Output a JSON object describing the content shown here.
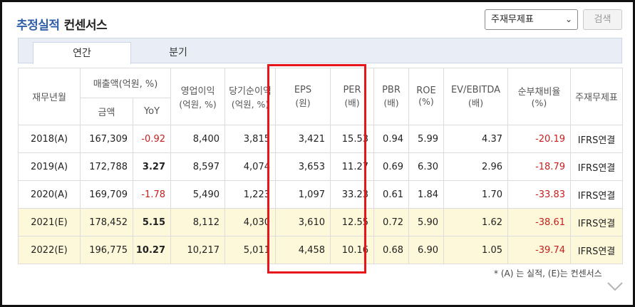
{
  "title": {
    "main": "추정실적",
    "sub": "컨센서스"
  },
  "select": {
    "value": "주재무제표"
  },
  "search_label": "검색",
  "tabs": [
    {
      "label": "연간"
    },
    {
      "label": "분기"
    }
  ],
  "columns": {
    "period": "재무년월",
    "sales": "매출액(억원, %)",
    "sales_amount": "금액",
    "sales_yoy": "YoY",
    "op_line1": "영업이익",
    "op_line2": "(억원, %)",
    "ni_line1": "당기순이익",
    "ni_line2": "(억원, %)",
    "eps_line1": "EPS",
    "eps_line2": "(원)",
    "per_line1": "PER",
    "per_line2": "(배)",
    "pbr_line1": "PBR",
    "pbr_line2": "(배)",
    "roe_line1": "ROE",
    "roe_line2": "(%)",
    "ev_line1": "EV/EBITDA",
    "ev_line2": "(배)",
    "debt_line1": "순부채비율",
    "debt_line2": "(%)",
    "basis": "주재무제표"
  },
  "rows": [
    {
      "period": "2018(A)",
      "sales": "167,309",
      "yoy": "-0.92",
      "op": "8,400",
      "ni": "3,815",
      "eps": "3,421",
      "per": "15.53",
      "pbr": "0.94",
      "roe": "5.99",
      "ev": "4.37",
      "debt": "-20.19",
      "basis": "IFRS연결"
    },
    {
      "period": "2019(A)",
      "sales": "172,788",
      "yoy": "3.27",
      "op": "8,597",
      "ni": "4,074",
      "eps": "3,653",
      "per": "11.27",
      "pbr": "0.69",
      "roe": "6.30",
      "ev": "2.96",
      "debt": "-18.79",
      "basis": "IFRS연결"
    },
    {
      "period": "2020(A)",
      "sales": "169,709",
      "yoy": "-1.78",
      "op": "5,490",
      "ni": "1,223",
      "eps": "1,097",
      "per": "33.23",
      "pbr": "0.61",
      "roe": "1.84",
      "ev": "1.70",
      "debt": "-33.83",
      "basis": "IFRS연결"
    },
    {
      "period": "2021(E)",
      "sales": "178,452",
      "yoy": "5.15",
      "op": "8,112",
      "ni": "4,030",
      "eps": "3,610",
      "per": "12.55",
      "pbr": "0.72",
      "roe": "5.90",
      "ev": "1.62",
      "debt": "-38.61",
      "basis": "IFRS연결"
    },
    {
      "period": "2022(E)",
      "sales": "196,775",
      "yoy": "10.27",
      "op": "10,217",
      "ni": "5,011",
      "eps": "4,458",
      "per": "10.16",
      "pbr": "0.68",
      "roe": "6.90",
      "ev": "1.05",
      "debt": "-39.74",
      "basis": "IFRS연결"
    }
  ],
  "note": "* (A) 는 실적, (E)는 컨센서스",
  "colors": {
    "negative": "#c81e1e",
    "estimate_row_bg": "#fcf8d9",
    "highlight_box": "#e8141c",
    "title_blue": "#2f5fa8"
  }
}
